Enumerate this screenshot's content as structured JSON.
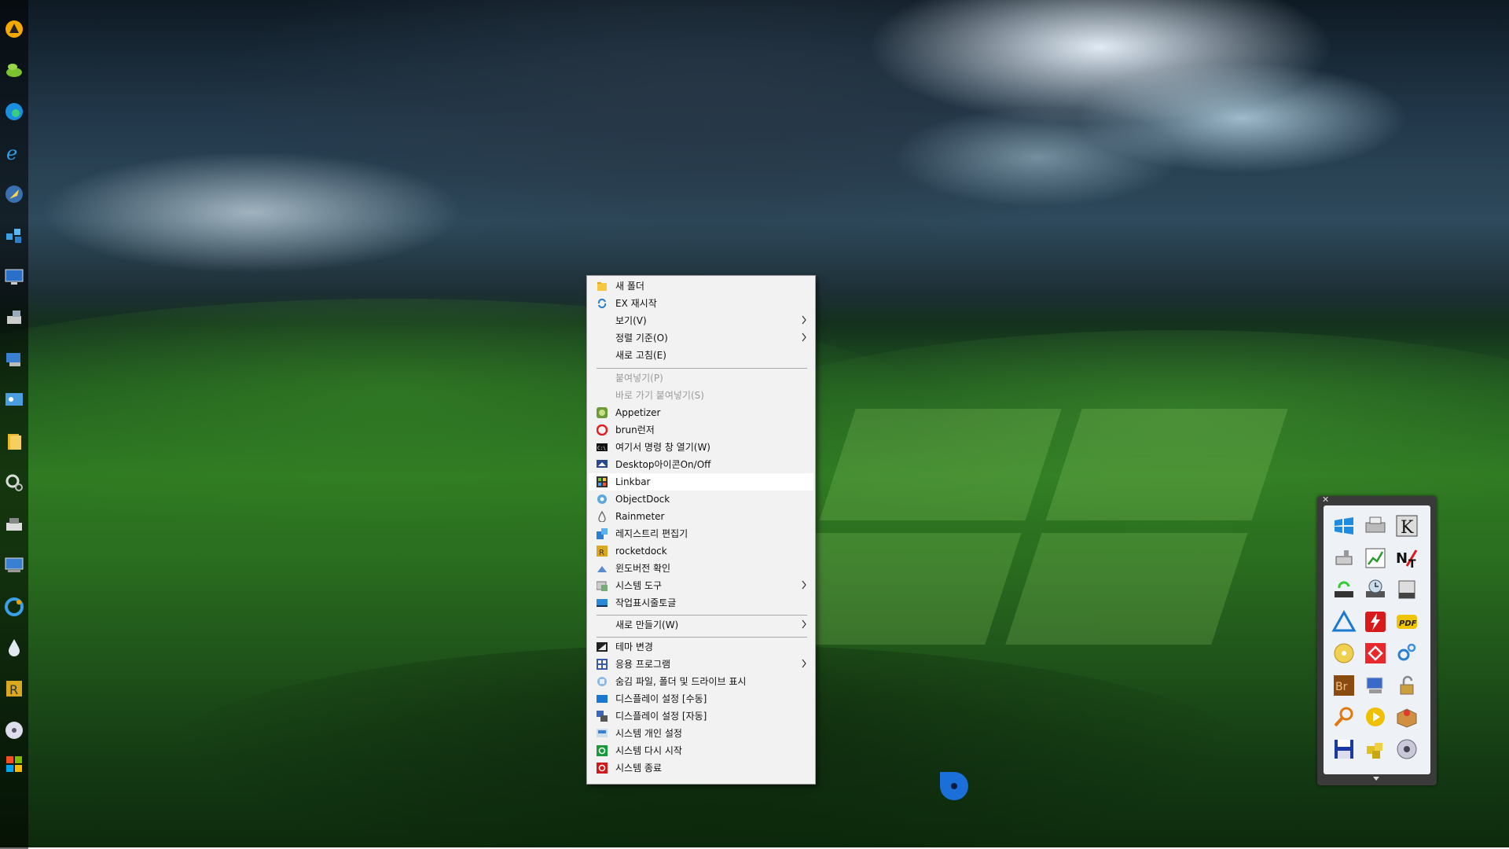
{
  "context_menu": {
    "items": [
      {
        "label": "새 폴더",
        "icon": "folder-icon",
        "disabled": false,
        "submenu": false
      },
      {
        "label": "EX 재시작",
        "icon": "refresh-icon",
        "disabled": false,
        "submenu": false
      },
      {
        "label": "보기(V)",
        "icon": "",
        "disabled": false,
        "submenu": true
      },
      {
        "label": "정렬 기준(O)",
        "icon": "",
        "disabled": false,
        "submenu": true
      },
      {
        "label": "새로 고침(E)",
        "icon": "",
        "disabled": false,
        "submenu": false
      },
      {
        "label": "붙여넣기(P)",
        "icon": "",
        "disabled": true,
        "submenu": false
      },
      {
        "label": "바로 가기 붙여넣기(S)",
        "icon": "",
        "disabled": true,
        "submenu": false
      },
      {
        "label": "Appetizer",
        "icon": "appetizer-icon",
        "disabled": false,
        "submenu": false
      },
      {
        "label": "brun런저",
        "icon": "brun-icon",
        "disabled": false,
        "submenu": false
      },
      {
        "label": "여기서 명령 창 열기(W)",
        "icon": "cmd-icon",
        "disabled": false,
        "submenu": false
      },
      {
        "label": "Desktop아이콘On/Off",
        "icon": "desktop-icon",
        "disabled": false,
        "submenu": false
      },
      {
        "label": "Linkbar",
        "icon": "linkbar-icon",
        "disabled": false,
        "submenu": false
      },
      {
        "label": "ObjectDock",
        "icon": "objectdock-icon",
        "disabled": false,
        "submenu": false
      },
      {
        "label": "Rainmeter",
        "icon": "rainmeter-icon",
        "disabled": false,
        "submenu": false
      },
      {
        "label": "레지스트리 편집기",
        "icon": "regedit-icon",
        "disabled": false,
        "submenu": false
      },
      {
        "label": "rocketdock",
        "icon": "rocketdock-icon",
        "disabled": false,
        "submenu": false
      },
      {
        "label": "윈도버전 확인",
        "icon": "winver-icon",
        "disabled": false,
        "submenu": false
      },
      {
        "label": "시스템 도구",
        "icon": "tools-icon",
        "disabled": false,
        "submenu": true
      },
      {
        "label": "작업표시줄토글",
        "icon": "taskbar-icon",
        "disabled": false,
        "submenu": false
      },
      {
        "label": "새로 만들기(W)",
        "icon": "",
        "disabled": false,
        "submenu": true
      },
      {
        "label": "테마 변경",
        "icon": "theme-icon",
        "disabled": false,
        "submenu": false
      },
      {
        "label": "응용 프로그램",
        "icon": "apps-icon",
        "disabled": false,
        "submenu": true
      },
      {
        "label": "숨김 파일, 폴더 및 드라이브 표시",
        "icon": "hidden-files-icon",
        "disabled": false,
        "submenu": false
      },
      {
        "label": "디스플레이 설정 [수동]",
        "icon": "display-manual-icon",
        "disabled": false,
        "submenu": false
      },
      {
        "label": "디스플레이 설정 [자동]",
        "icon": "display-auto-icon",
        "disabled": false,
        "submenu": false
      },
      {
        "label": "시스템 개인 설정",
        "icon": "personalize-icon",
        "disabled": false,
        "submenu": false
      },
      {
        "label": "시스템 다시 시작",
        "icon": "restart-icon",
        "disabled": false,
        "submenu": false
      },
      {
        "label": "시스템 종료",
        "icon": "shutdown-icon",
        "disabled": false,
        "submenu": false
      }
    ],
    "highlighted": "Linkbar"
  },
  "left_bar": {
    "icons": [
      "aimp-icon",
      "appetizer-leaf-icon",
      "edge-icon",
      "internet-explorer-icon",
      "rocket-icon",
      "network-cubes-icon",
      "monitor-icon",
      "computer-drive-icon",
      "pc-network-icon",
      "control-panel-icon",
      "folder-icon",
      "settings-gears-icon",
      "drive-icon",
      "display-settings-icon",
      "ccleaner-icon",
      "rainmeter-drop-icon",
      "rocketdock-icon",
      "dvd-icon",
      "windows-flag-icon"
    ]
  },
  "dock": {
    "icons": [
      "windows-logo-icon",
      "printer-icon",
      "k-app-icon",
      "usb-drive-icon",
      "chart-icon",
      "notepad-plus-icon",
      "refresh-drive-icon",
      "time-machine-icon",
      "hard-drive-icon",
      "triangle-app-icon",
      "flash-icon",
      "pdf-icon",
      "cd-icon",
      "anydesk-icon",
      "gear-icon",
      "bridge-icon",
      "computer-icon",
      "unlock-icon",
      "search-icon",
      "play-icon",
      "package-icon",
      "save-disk-icon",
      "puzzle-icon",
      "dvd-icon"
    ]
  },
  "colors": {
    "menu_bg": "#f2f2f2",
    "menu_highlight": "#ffffff",
    "menu_disabled_text": "#9a9a9a",
    "dock_bg": "#3a3a3a"
  }
}
